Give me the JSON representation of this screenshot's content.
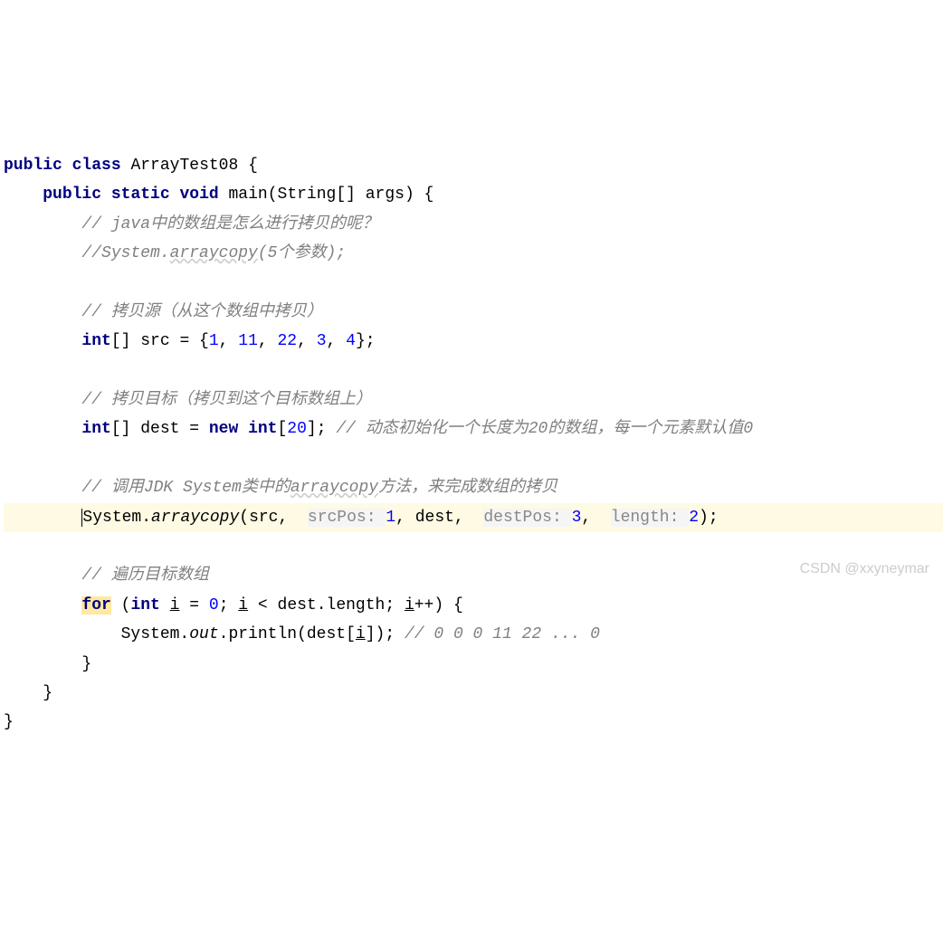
{
  "code": {
    "class_decl": {
      "kw_public": "public",
      "kw_class": "class",
      "class_name": "ArrayTest08",
      "brace_open": " {"
    },
    "main_decl": {
      "kw_public": "public",
      "kw_static": "static",
      "kw_void": "void",
      "name": "main",
      "params": "(String[] args) {"
    },
    "comment1": "// java中的数组是怎么进行拷贝的呢？",
    "comment2_a": "//System.",
    "comment2_b": "arraycopy",
    "comment2_c": "(5个参数);",
    "comment3": "// 拷贝源（从这个数组中拷贝）",
    "src_decl": {
      "kw_int": "int",
      "brackets": "[]",
      "varname": " src = {",
      "n1": "1",
      "c1": ", ",
      "n2": "11",
      "c2": ", ",
      "n3": "22",
      "c3": ", ",
      "n4": "3",
      "c4": ", ",
      "n5": "4",
      "close": "};"
    },
    "comment4": "// 拷贝目标（拷贝到这个目标数组上）",
    "dest_decl": {
      "kw_int": "int",
      "brackets": "[]",
      "var": " dest = ",
      "kw_new": "new",
      "sp": " ",
      "kw_int2": "int",
      "br_open": "[",
      "size": "20",
      "br_close": "]; ",
      "comment": "// 动态初始化一个长度为20的数组，每一个元素默认值0"
    },
    "comment5_a": "// 调用JDK System类中的",
    "comment5_b": "arraycopy",
    "comment5_c": "方法，来完成数组的拷贝",
    "arraycopy": {
      "sys": "System.",
      "method": "arraycopy",
      "p_open": "(src,  ",
      "hint1": "srcPos: ",
      "n1": "1",
      "c1": ", dest,  ",
      "hint2": "destPos: ",
      "n2": "3",
      "c2": ",  ",
      "hint3": "length: ",
      "n3": "2",
      "close": ");"
    },
    "comment6": "// 遍历目标数组",
    "for_loop": {
      "kw_for": "for",
      "sp": " (",
      "kw_int": "int",
      "sp2": " ",
      "i1": "i",
      "eq": " = ",
      "n0": "0",
      "semi": "; ",
      "i2": "i",
      "lt": " < dest.length; ",
      "i3": "i",
      "inc": "++) {"
    },
    "println": {
      "pre": "System.",
      "out": "out",
      "mid": ".println(des",
      "cursor_t": "t",
      "br_open": "[",
      "i": "i",
      "close": "]); ",
      "comment": "// 0 0 0 11 22 ... 0"
    },
    "brace1": "}",
    "brace2": "}",
    "brace3": "}"
  },
  "watermark": "CSDN @xxyneymar"
}
